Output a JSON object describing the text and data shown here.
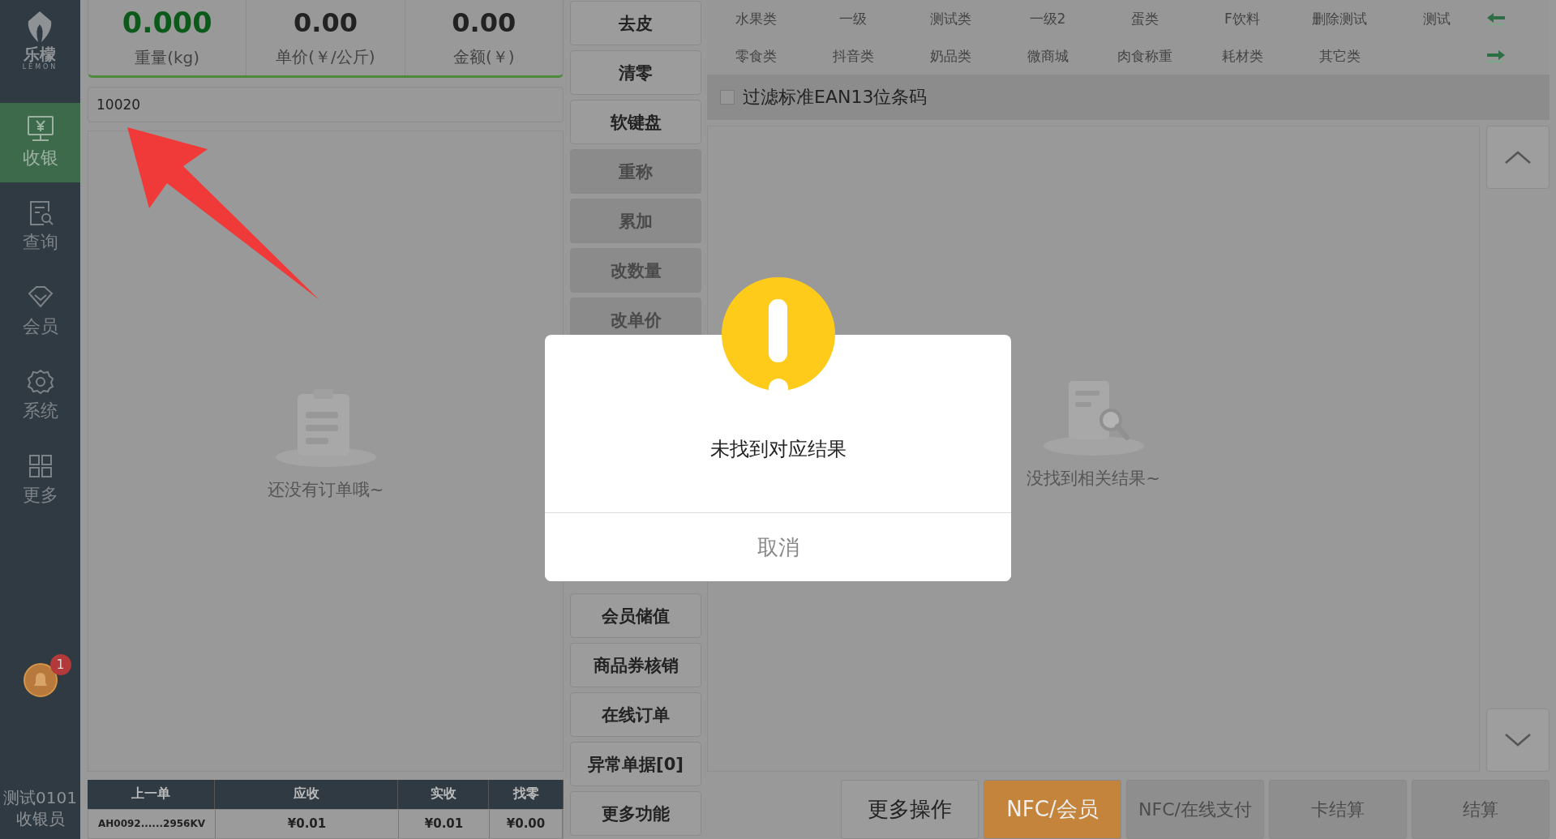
{
  "sidebar": {
    "logo_text": "乐檬",
    "logo_subtext": "LEMON",
    "items": [
      {
        "label": "收银",
        "selected": true
      },
      {
        "label": "查询",
        "selected": false
      },
      {
        "label": "会员",
        "selected": false
      },
      {
        "label": "系统",
        "selected": false
      },
      {
        "label": "更多",
        "selected": false
      }
    ],
    "notification_count": "1",
    "user": {
      "name": "测试0101",
      "role": "收银员"
    }
  },
  "scale": {
    "readouts": [
      {
        "value": "0.000",
        "label": "重量(kg)",
        "highlight": true
      },
      {
        "value": "0.00",
        "label": "单价(￥/公斤)",
        "highlight": false
      },
      {
        "value": "0.00",
        "label": "金额(￥)",
        "highlight": false
      }
    ]
  },
  "barcode_input": {
    "value": "10020"
  },
  "order_list": {
    "empty_text": "还没有订单哦~"
  },
  "last_order": {
    "columns": [
      "上一单",
      "应收",
      "实收",
      "找零"
    ],
    "row": [
      "AH0092......2956KV",
      "¥0.01",
      "¥0.01",
      "¥0.00"
    ]
  },
  "function_buttons_top": [
    {
      "label": "去皮",
      "disabled": false
    },
    {
      "label": "清零",
      "disabled": false
    },
    {
      "label": "软键盘",
      "disabled": false
    },
    {
      "label": "重称",
      "disabled": true
    },
    {
      "label": "累加",
      "disabled": true
    },
    {
      "label": "改数量",
      "disabled": true
    },
    {
      "label": "改单价",
      "disabled": true
    }
  ],
  "function_buttons_bottom": [
    {
      "label": "会员储值",
      "disabled": false
    },
    {
      "label": "商品券核销",
      "disabled": false
    },
    {
      "label": "在线订单",
      "disabled": false
    },
    {
      "label": "异常单据[0]",
      "disabled": false
    },
    {
      "label": "更多功能",
      "disabled": false
    }
  ],
  "categories": [
    [
      "水果类",
      "一级",
      "测试类",
      "一级2",
      "蛋类",
      "F饮料",
      "删除测试",
      "测试"
    ],
    [
      "零食类",
      "抖音类",
      "奶品类",
      "微商城",
      "肉食称重",
      "耗材类",
      "其它类"
    ]
  ],
  "filter": {
    "label": "过滤标准EAN13位条码",
    "checked": false
  },
  "results": {
    "empty_text": "没找到相关结果~"
  },
  "action_buttons": [
    {
      "label": "更多操作",
      "kind": "normal"
    },
    {
      "label": "NFC/会员",
      "kind": "primary"
    },
    {
      "label": "NFC/在线支付",
      "kind": "disabled"
    },
    {
      "label": "卡结算",
      "kind": "disabled"
    },
    {
      "label": "结算",
      "kind": "disabled"
    }
  ],
  "dialog": {
    "message": "未找到对应结果",
    "button": "取消"
  }
}
